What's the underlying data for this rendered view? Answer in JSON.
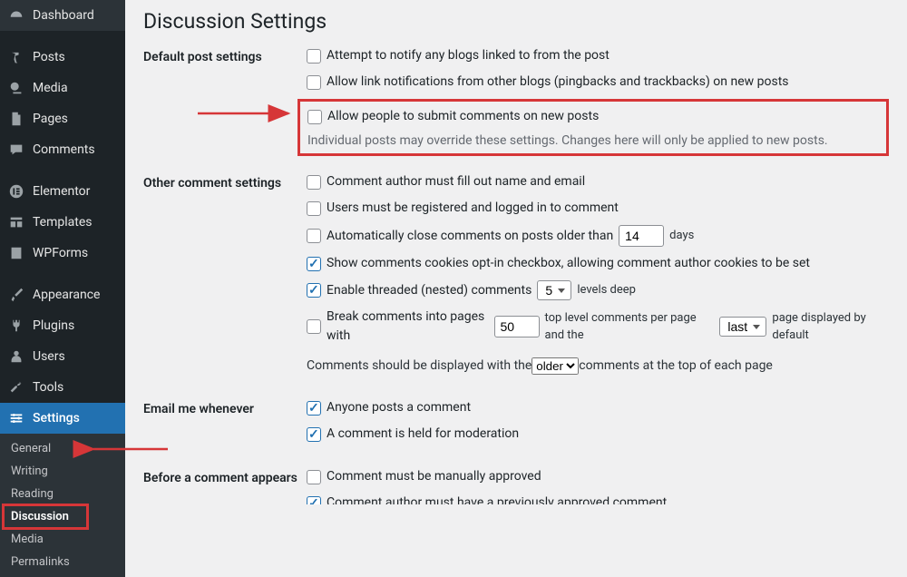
{
  "sidebar": {
    "items": [
      {
        "label": "Dashboard",
        "icon": "dashboard"
      },
      {
        "label": "Posts",
        "icon": "pin"
      },
      {
        "label": "Media",
        "icon": "media"
      },
      {
        "label": "Pages",
        "icon": "page"
      },
      {
        "label": "Comments",
        "icon": "comment"
      },
      {
        "label": "Elementor",
        "icon": "elementor"
      },
      {
        "label": "Templates",
        "icon": "templates"
      },
      {
        "label": "WPForms",
        "icon": "wpforms"
      },
      {
        "label": "Appearance",
        "icon": "brush"
      },
      {
        "label": "Plugins",
        "icon": "plugin"
      },
      {
        "label": "Users",
        "icon": "user"
      },
      {
        "label": "Tools",
        "icon": "tool"
      },
      {
        "label": "Settings",
        "icon": "settings",
        "active": true
      }
    ],
    "submenu": [
      {
        "label": "General"
      },
      {
        "label": "Writing"
      },
      {
        "label": "Reading"
      },
      {
        "label": "Discussion",
        "current": true
      },
      {
        "label": "Media"
      },
      {
        "label": "Permalinks"
      }
    ]
  },
  "page": {
    "title": "Discussion Settings",
    "sections": {
      "default_post": {
        "heading": "Default post settings",
        "opt1": "Attempt to notify any blogs linked to from the post",
        "opt2": "Allow link notifications from other blogs (pingbacks and trackbacks) on new posts",
        "opt3": "Allow people to submit comments on new posts",
        "note": "Individual posts may override these settings. Changes here will only be applied to new posts."
      },
      "other_comment": {
        "heading": "Other comment settings",
        "opt1": "Comment author must fill out name and email",
        "opt2": "Users must be registered and logged in to comment",
        "opt3_prefix": "Automatically close comments on posts older than",
        "opt3_value": "14",
        "opt3_suffix": "days",
        "opt4": "Show comments cookies opt-in checkbox, allowing comment author cookies to be set",
        "opt5_prefix": "Enable threaded (nested) comments",
        "opt5_value": "5",
        "opt5_suffix": "levels deep",
        "opt6_prefix": "Break comments into pages with",
        "opt6_value": "50",
        "opt6_mid": "top level comments per page and the",
        "opt6_select": "last",
        "opt6_suffix": "page displayed by default",
        "display_prefix": "Comments should be displayed with the",
        "display_value": "older",
        "display_suffix": "comments at the top of each page"
      },
      "email_me": {
        "heading": "Email me whenever",
        "opt1": "Anyone posts a comment",
        "opt2": "A comment is held for moderation"
      },
      "before_appears": {
        "heading": "Before a comment appears",
        "opt1": "Comment must be manually approved",
        "opt2": "Comment author must have a previously approved comment"
      }
    }
  }
}
